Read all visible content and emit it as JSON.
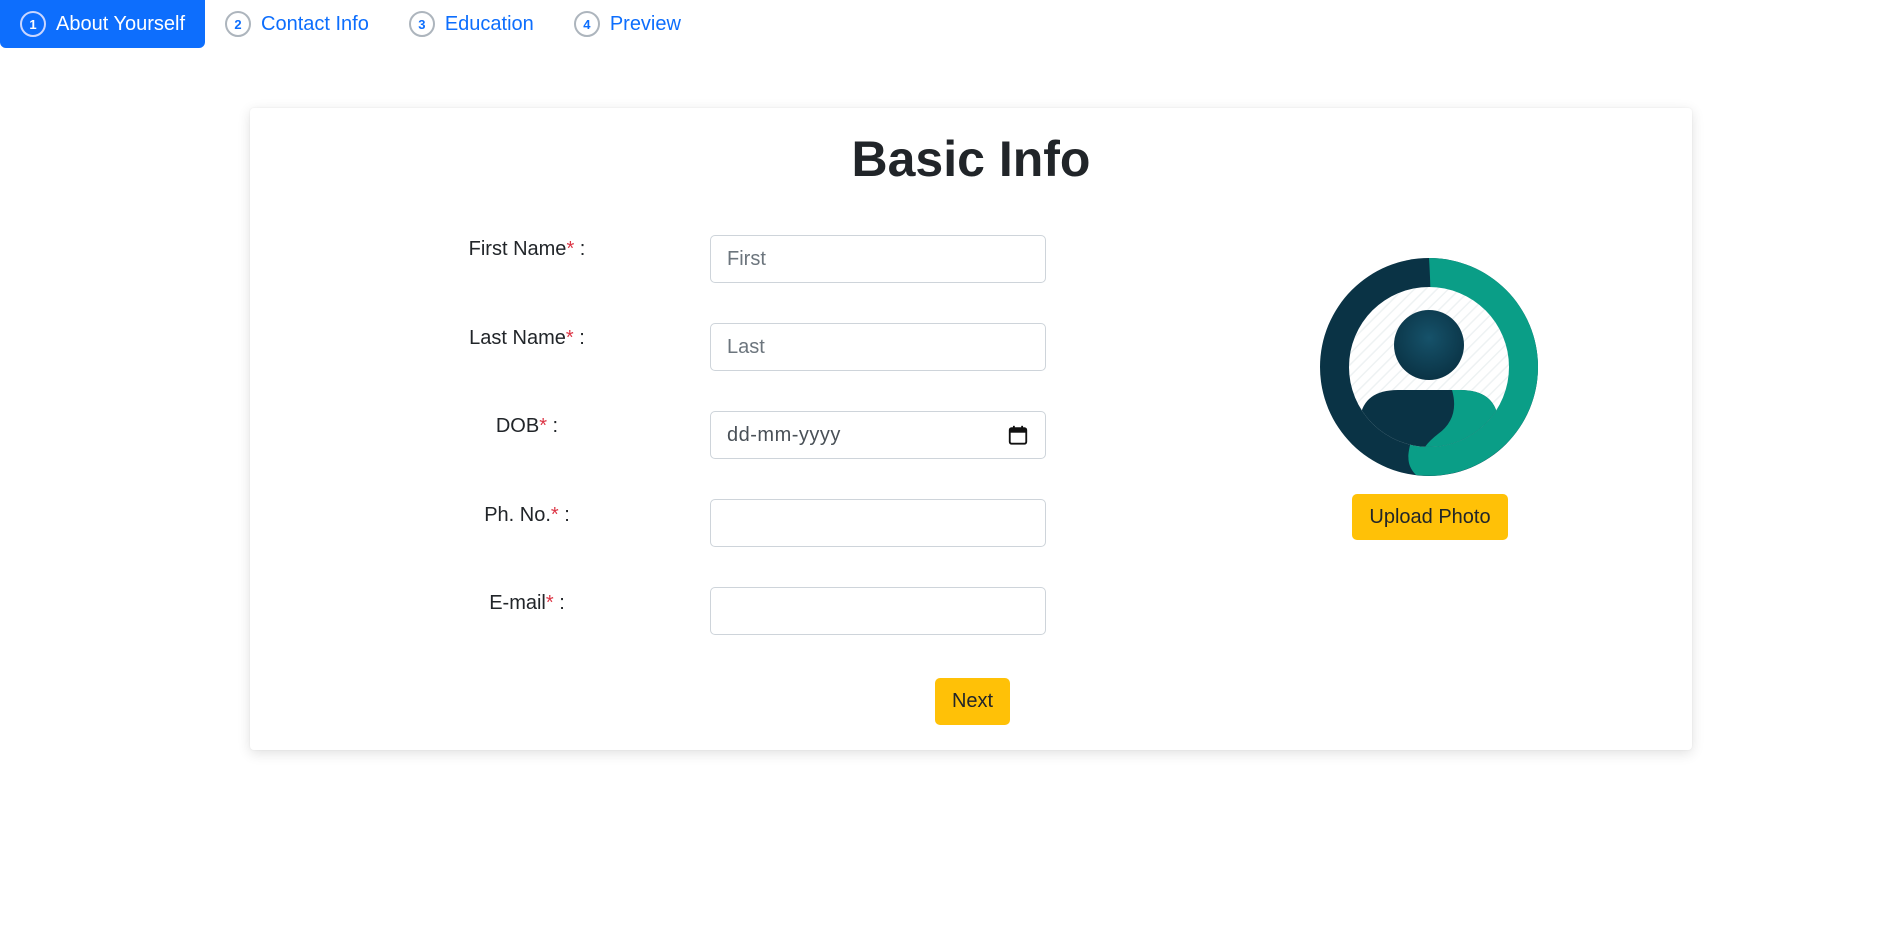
{
  "steps": [
    {
      "num": "1",
      "label": "About Yourself",
      "active": true
    },
    {
      "num": "2",
      "label": "Contact Info",
      "active": false
    },
    {
      "num": "3",
      "label": "Education",
      "active": false
    },
    {
      "num": "4",
      "label": "Preview",
      "active": false
    }
  ],
  "form": {
    "title": "Basic Info",
    "required_mark": "*",
    "fields": {
      "first_name": {
        "label": "First Name",
        "suffix": " :",
        "placeholder": "First",
        "value": ""
      },
      "last_name": {
        "label": "Last Name",
        "suffix": " :",
        "placeholder": "Last",
        "value": ""
      },
      "dob": {
        "label": "DOB",
        "suffix": " :",
        "placeholder": "dd-mm-yyyy",
        "value": ""
      },
      "phone": {
        "label": "Ph. No.",
        "suffix": " :",
        "placeholder": "",
        "value": ""
      },
      "email": {
        "label": "E-mail",
        "suffix": " :",
        "placeholder": "",
        "value": ""
      }
    },
    "upload_label": "Upload Photo",
    "next_label": "Next"
  },
  "icons": {
    "avatar": "user-avatar-icon",
    "calendar": "calendar-icon"
  },
  "colors": {
    "primary": "#0d6efd",
    "warning": "#ffc107",
    "required": "#dc3545",
    "avatar_dark": "#0a3345",
    "avatar_teal": "#0a9e87"
  }
}
